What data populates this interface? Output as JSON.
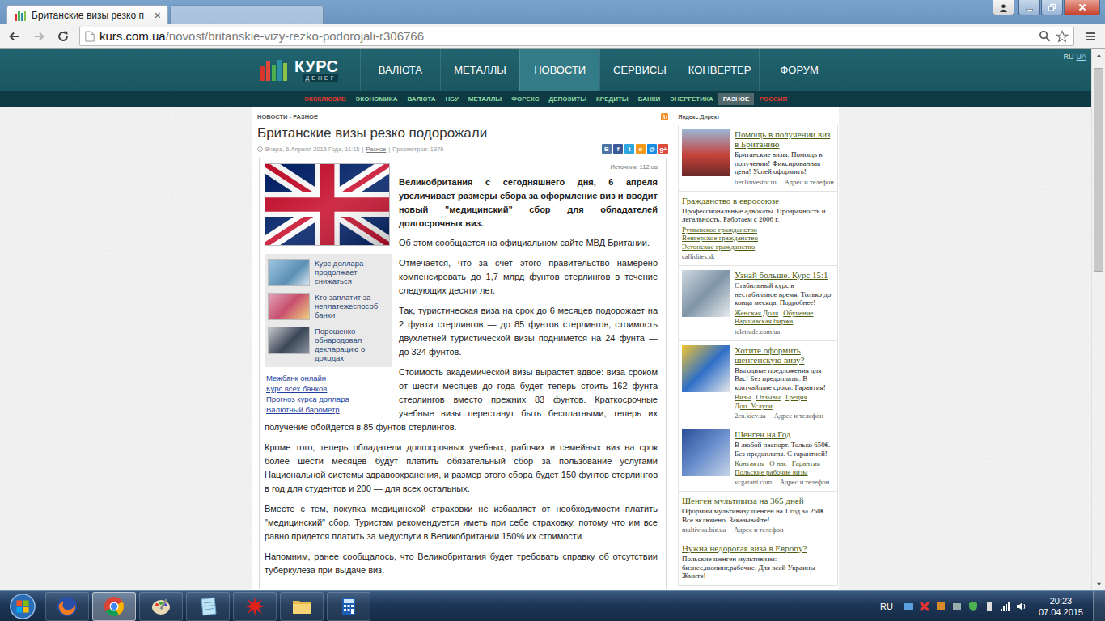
{
  "window": {
    "tabs": [
      {
        "label": "Британские визы резко п",
        "close": "×",
        "selected": true
      },
      {
        "label": "",
        "close": "",
        "selected": false
      }
    ]
  },
  "browser": {
    "url_host": "kurs.com.ua",
    "url_path": "/novost/britanskie-vizy-rezko-podorojali-r306766",
    "back_disabled": false,
    "forward_disabled": true
  },
  "site": {
    "logo": {
      "main": "КУРС",
      "sub": "ДЕНЕГ"
    },
    "languages": [
      {
        "label": "RU",
        "selected": true
      },
      {
        "label": "UA",
        "selected": false
      }
    ],
    "nav": [
      {
        "label": "ВАЛЮТА",
        "selected": false
      },
      {
        "label": "МЕТАЛЛЫ",
        "selected": false
      },
      {
        "label": "НОВОСТИ",
        "selected": true
      },
      {
        "label": "СЕРВИСЫ",
        "selected": false
      },
      {
        "label": "КОНВЕРТЕР",
        "selected": false
      },
      {
        "label": "ФОРУМ",
        "selected": false
      }
    ],
    "subnav": [
      {
        "label": "ЭКСКЛЮЗИВ",
        "selected": false,
        "color": "#e8352b"
      },
      {
        "label": "ЭКОНОМИКА",
        "selected": false,
        "color": "#8fd9a8"
      },
      {
        "label": "ВАЛЮТА",
        "selected": false,
        "color": "#8fd9a8"
      },
      {
        "label": "НБУ",
        "selected": false,
        "color": "#8fd9a8"
      },
      {
        "label": "МЕТАЛЛЫ",
        "selected": false,
        "color": "#8fd9a8"
      },
      {
        "label": "ФОРЕКС",
        "selected": false,
        "color": "#8fd9a8"
      },
      {
        "label": "ДЕПОЗИТЫ",
        "selected": false,
        "color": "#8fd9a8"
      },
      {
        "label": "КРЕДИТЫ",
        "selected": false,
        "color": "#8fd9a8"
      },
      {
        "label": "БАНКИ",
        "selected": false,
        "color": "#8fd9a8"
      },
      {
        "label": "ЭНЕРГЕТИКА",
        "selected": false,
        "color": "#8fd9a8"
      },
      {
        "label": "РАЗНОЕ",
        "selected": true,
        "color": "#ffffff"
      },
      {
        "label": "РОССИЯ",
        "selected": false,
        "color": "#e8352b"
      }
    ]
  },
  "article": {
    "breadcrumb": "НОВОСТИ - РАЗНОЕ",
    "title": "Британские визы резко подорожали",
    "meta": {
      "date": "Вчера, 6 Апреля 2015 Года, 11:15",
      "separator": "|",
      "category": "Разное",
      "views": "Просмотров: 1376"
    },
    "share": [
      {
        "label": "В",
        "color": "#4c75a3"
      },
      {
        "label": "f",
        "color": "#3b5998"
      },
      {
        "label": "t",
        "color": "#2ca7e0"
      },
      {
        "label": "о",
        "color": "#f59a1b"
      },
      {
        "label": "@",
        "color": "#168de2"
      },
      {
        "label": "g+",
        "color": "#dd4b39"
      }
    ],
    "source": "Источник: 112.ua",
    "lead": "Великобритания с сегодняшнего дня, 6 апреля увеличивает размеры сбора за оформление виз и вводит новый \"медицинский\" сбор для обладателей долгосрочных виз.",
    "paragraphs": [
      "Об этом сообщается на официальном сайте МВД Британии.",
      "Отмечается, что за счет этого правительство намерено компенсировать до 1,7 млрд фунтов стерлингов в течение следующих десяти лет.",
      "Так, туристическая виза на срок до 6 месяцев подорожает на 2 фунта стерлингов — до 85 фунтов стерлингов, стоимость двухлетней туристической визы поднимется на 24 фунта — до 324 фунтов.",
      "Стоимость академической визы вырастет вдвое: виза сроком от шести месяцев до года будет теперь стоить 162 фунта стерлингов вместо прежних 83 фунтов. Краткосрочные учебные визы перестанут быть бесплатными, теперь их получение обойдется в 85 фунтов стерлингов.",
      "Кроме того, теперь обладатели долгосрочных учебных, рабочих и семейных виз на срок более шести месяцев будут платить обязательный сбор за пользование услугами Национальной системы здравоохранения, и размер этого сбора будет 150 фунтов стерлингов в год для студентов и 200 — для всех остальных.",
      "Вместе с тем, покупка медицинской страховки не избавляет от необходимости платить \"медицинский\" сбор. Туристам рекомендуется иметь при себе страховку, потому что им все равно придется платить за медуслуги в Великобритании 150% их стоимости.",
      "Напомним, ранее сообщалось, что Великобритания будет требовать справку об отсутствии туберкулеза при выдаче виз."
    ],
    "related": [
      "Курс доллара продолжает снижаться",
      "Кто заплатит за неплатежеспособ банки",
      "Порошенко обнародовал декларацию о доходах"
    ],
    "links": [
      "Межбанк онлайн",
      "Курс всех банков",
      "Прогноз курса доллара",
      "Валютный барометр"
    ]
  },
  "sidebar": {
    "header": "Яндекс.Директ",
    "ads": [
      {
        "kind": "image",
        "title": "Помощь в получении виз в Британию",
        "text": "Британские визы. Помощь в получении! Фиксированная цена! Успей оформить!",
        "links": [],
        "domain": "tier1investor.ru",
        "contact": "Адрес и телефон"
      },
      {
        "kind": "text",
        "title": "Гражданство в евросоюзе",
        "text": "Профессиональные адвокаты. Прозрачность и легальность. Работаем с 2006 г.",
        "links": [
          "Румынское гражданство",
          "Венгерское гражданство",
          "Эстонское гражданство"
        ],
        "domain": "callidites.sk",
        "contact": ""
      },
      {
        "kind": "image",
        "title": "Узнай больше. Курс 15:1",
        "text": "Стабильный курс в нестабильное время. Только до конца месяца. Подробнее!",
        "links": [
          "Женская Доля",
          "Обучение",
          "Варшавская биржа"
        ],
        "domain": "teletrade.com.ua",
        "contact": ""
      },
      {
        "kind": "image",
        "title": "Хотите оформить шенгенскую визу?",
        "text": "Выгодные предложения для Вас! Без предоплаты. В кратчайшие сроки. Гарантия!",
        "links": [
          "Визы",
          "Отзывы",
          "Греция",
          "Доп. Услуги"
        ],
        "domain": "2eu.kiev.ua",
        "contact": "Адрес и телефон"
      },
      {
        "kind": "image",
        "title": "Шенген на Год",
        "text": "В любой паспорт. Только 650€. Без предоплаты. С гарантией!",
        "links": [
          "Контакты",
          "О нас",
          "Гарантия",
          "Польские рабочие визы"
        ],
        "domain": "vcgarant.com",
        "contact": "Адрес и телефон"
      },
      {
        "kind": "text",
        "title": "Шенген мультивиза на 365 дней",
        "text": "Оформим мультивизу шенген на 1 год за 250€. Все включено. Заказывайте!",
        "links": [],
        "domain": "multivisa.biz.ua",
        "contact": "Адрес и телефон"
      },
      {
        "kind": "text",
        "title": "Нужна недорогая виза в Европу?",
        "text": "Польские шенген мультивизы: бизнес,шопинг,рабочие. Для всей Украины Жмите!",
        "links": [],
        "domain": "",
        "contact": ""
      }
    ]
  },
  "scrollbar": {
    "level": 0.02
  },
  "taskbar": {
    "apps": [
      {
        "kind": "firefox",
        "selected": false
      },
      {
        "kind": "chrome",
        "selected": true
      },
      {
        "kind": "paint",
        "selected": false
      },
      {
        "kind": "notepad",
        "selected": false
      },
      {
        "kind": "splat",
        "selected": false
      },
      {
        "kind": "folder",
        "selected": false
      },
      {
        "kind": "calculator",
        "selected": false
      }
    ],
    "language": "RU",
    "time": "20:23",
    "date": "07.04.2015"
  }
}
